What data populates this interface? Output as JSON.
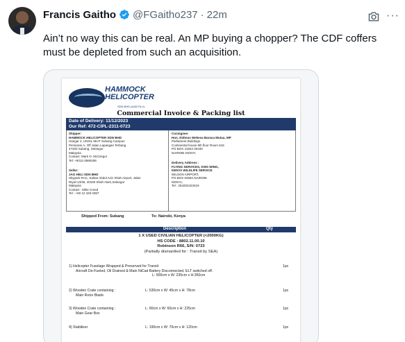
{
  "tweet": {
    "author_name": "Francis Gaitho",
    "handle": "@FGaitho237",
    "separator": "·",
    "time": "22m",
    "text": "Ain’t no way this can be real. An MP buying a chopper? The CDF coffers must be depleted from such an acquisition."
  },
  "document": {
    "logo_line1": "HAMMOCK",
    "logo_line2": "HELICOPTER",
    "logo_sub": "SDN BHD (643278-V)",
    "title": "Commercial Invoice & Packing list",
    "date_line": "Date of Delivery: 11/12/2023",
    "ref_line": "Our  Ref: 472-CIPL-2311-0723",
    "shipper": {
      "heading": "Shipper:",
      "lines": [
        "HAMMOCK HELICOPTER SDN BHD",
        "Hangar 2, UNISL MIAT Subang Campus",
        "Persiaran A, Off Jalan Lapangan Terbang",
        "47200 Subang, Selangor",
        "Malaysia",
        "Contact: Mark O. McGregor",
        "Tel: +6012-2869186"
      ]
    },
    "seller": {
      "heading": "Seller:",
      "lines": [
        "JAG HELI SDN BHD",
        "Skypark RAC, Sultan Abdul Aziz Shah Airport, Jalan",
        "Riyal U3/36, 40150 Shah Alam,Selangor",
        "Malaysia",
        "Contact : Mike Creed",
        "Tel : +60 12 425 0387"
      ]
    },
    "consignee": {
      "heading": "Consignee:",
      "lines": [
        "Hon. Didmus Wekesa Barasa Mutua, MP",
        "Parliament Buildings",
        "Continental house 6th floor Room 615",
        "PO BOX 41842 00100",
        "NAIROBI KENYA"
      ]
    },
    "delivery": {
      "heading": "Delivery Address :",
      "lines": [
        "FLYING SERVICES, KWS WING,",
        "KENYA WILDLIFE SERVICE",
        "WILSON AIRPORT,",
        "PO BOX 54582 NAIROBI",
        "KENYA,",
        "Tel : 254202423419"
      ]
    },
    "shipped_from": "Shipped From: Subang",
    "shipped_to": "To: Nairobi, Kenya",
    "col_description": "Description",
    "col_qty": "Qty",
    "item_title": "1 X USED CIVILIAN HELICOPTER (<2000KG)",
    "hs_code": "HS CODE : 8802.11.00.10",
    "model": "Robinson R66, S/N: 0723",
    "note": "(Partially dismantled for : Transit by SEA)",
    "items": [
      {
        "line1": "1) Helicopter Fuselage Wrapped & Preserved for Transit",
        "line2": "Aircraft De-Fueled, Oil Drained & Main NiCad Battery Disconnected, ELT switched off.",
        "line3": "L: 900cm x W: 235cm x H:350cm",
        "qty": "1pc"
      },
      {
        "line1": "2) Wooden Crate containing :",
        "line2": "Main Rotor Blade",
        "dims": "L: 530cm x W: 45cm x H: 78cm",
        "qty": "1pc"
      },
      {
        "line1": "3) Wooden Crate containing :",
        "line2": "Main Gear Box",
        "dims": "L: 90cm x W: 60cm x H: 225cm",
        "qty": "1pc"
      },
      {
        "line1": "4) Stabilizer",
        "dims": "L: 190cm x W: 70cm x H: 120cm",
        "qty": "1pc"
      }
    ]
  },
  "colors": {
    "accent": "#1d9bf0",
    "doc_header": "#1f3a6b",
    "text": "#0f1419",
    "muted": "#536471"
  },
  "icons": [
    "verified-badge-icon",
    "camera-icon",
    "more-icon"
  ]
}
